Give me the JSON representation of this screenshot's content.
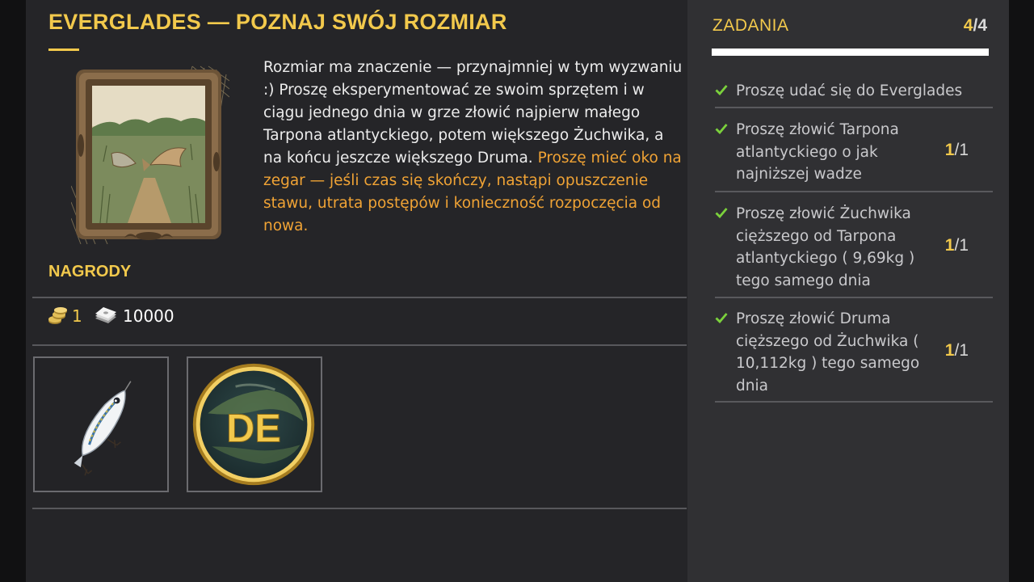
{
  "challenge": {
    "title": "EVERGLADES — POZNAJ SWÓJ ROZMIAR",
    "description": "Rozmiar ma znaczenie — przynajmniej w tym wyzwaniu :) Proszę eksperymentować ze swoim sprzętem i w ciągu jednego dnia w grze złowić najpierw małego Tarpona atlantyckiego, potem większego Żuchwika, a na końcu jeszcze większego Druma.",
    "warning": "Proszę mieć oko na zegar — jeśli czas się skończy, nastąpi opuszczenie stawu, utrata postępów i konieczność rozpoczęcia od nowa.",
    "image_icon": "framed-fish-picture"
  },
  "rewards": {
    "label": "NAGRODY",
    "coins": "1",
    "coins_icon": "gold-coins-icon",
    "cash": "10000",
    "cash_icon": "banknotes-icon",
    "items": [
      {
        "icon": "lure-icon"
      },
      {
        "icon": "everglades-badge-icon",
        "badge_text": "DE"
      }
    ]
  },
  "tasks": {
    "title": "ZADANIA",
    "completed": "4",
    "total": "4",
    "count_sep": "/",
    "progress_fraction": 1.0,
    "check_color": "#7bd13c",
    "list": [
      {
        "text": "Proszę udać się do Everglades",
        "done": true
      },
      {
        "text": "Proszę złowić Tarpona atlantyckiego o jak najniższej wadze",
        "current": "1",
        "total": "1",
        "sep": "/",
        "done": true
      },
      {
        "text": "Proszę złowić Żuchwika cięższego od Tarpona atlantyckiego ( 9,69kg ) tego samego dnia",
        "current": "1",
        "total": "1",
        "sep": "/",
        "done": true
      },
      {
        "text": "Proszę złowić Druma cięższego od Żuchwika ( 10,112kg ) tego samego dnia",
        "current": "1",
        "total": "1",
        "sep": "/",
        "done": true
      }
    ]
  },
  "colors": {
    "accent": "#f2c94c",
    "warning": "#f0a335",
    "panel": "#252528",
    "side_panel": "#303033"
  }
}
